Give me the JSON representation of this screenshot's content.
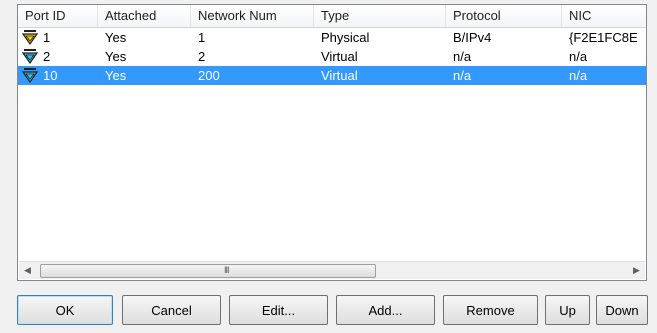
{
  "columns": [
    "Port ID",
    "Attached",
    "Network Num",
    "Type",
    "Protocol",
    "NIC"
  ],
  "rows": [
    {
      "port_id": "1",
      "attached": "Yes",
      "network_num": "1",
      "type": "Physical",
      "protocol": "B/IPv4",
      "nic": "{F2E1FC8E",
      "icon": "port-physical-icon",
      "selected": false
    },
    {
      "port_id": "2",
      "attached": "Yes",
      "network_num": "2",
      "type": "Virtual",
      "protocol": "n/a",
      "nic": "n/a",
      "icon": "port-virtual-icon",
      "selected": false
    },
    {
      "port_id": "10",
      "attached": "Yes",
      "network_num": "200",
      "type": "Virtual",
      "protocol": "n/a",
      "nic": "n/a",
      "icon": "port-virtual-icon",
      "selected": true
    }
  ],
  "scrollbar": {
    "grip": "III"
  },
  "buttons": {
    "ok": "OK",
    "cancel": "Cancel",
    "edit": "Edit...",
    "add": "Add...",
    "remove": "Remove",
    "up": "Up",
    "down": "Down"
  },
  "colors": {
    "selection": "#3399ff",
    "icon_yellow": "#f5d000",
    "icon_cyan": "#33c7f0"
  }
}
